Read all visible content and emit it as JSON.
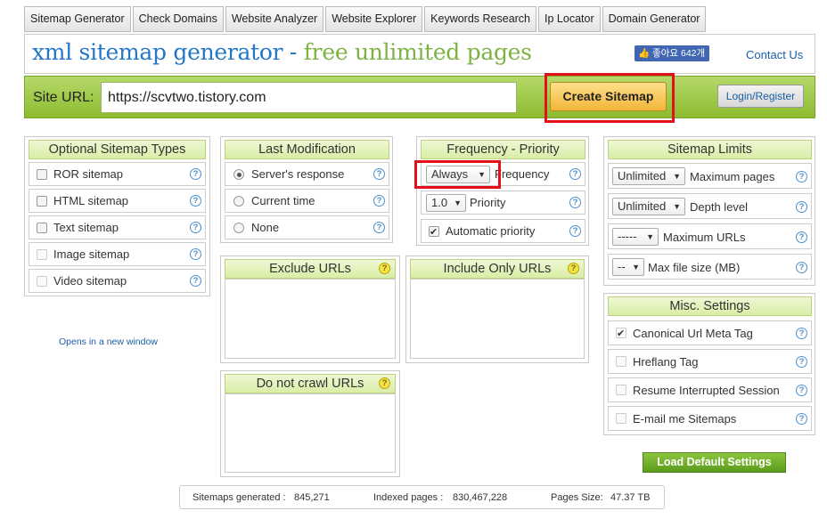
{
  "tabs": [
    "Sitemap Generator",
    "Check Domains",
    "Website Analyzer",
    "Website Explorer",
    "Keywords Research",
    "Ip Locator",
    "Domain Generator"
  ],
  "header": {
    "title_main": "xml sitemap generator",
    "title_dash": " - ",
    "title_free": "free unlimited pages",
    "like_label": "좋아요 642개",
    "contact": "Contact Us"
  },
  "urlbar": {
    "label": "Site URL:",
    "value": "https://scvtwo.tistory.com",
    "create": "Create Sitemap",
    "login": "Login/Register"
  },
  "optional": {
    "title": "Optional Sitemap Types",
    "items": [
      "ROR sitemap",
      "HTML sitemap",
      "Text sitemap",
      "Image sitemap",
      "Video sitemap"
    ]
  },
  "lastmod": {
    "title": "Last Modification",
    "items": [
      "Server's response",
      "Current time",
      "None"
    ],
    "selected": "Server's response"
  },
  "frequency": {
    "title": "Frequency - Priority",
    "frequency_value": "Always",
    "frequency_label": "Frequency",
    "priority_value": "1.0",
    "priority_label": "Priority",
    "auto_label": "Automatic priority",
    "auto_checked": true
  },
  "limits": {
    "title": "Sitemap Limits",
    "rows": [
      {
        "value": "Unlimited",
        "label": "Maximum pages"
      },
      {
        "value": "Unlimited",
        "label": "Depth level"
      },
      {
        "value": "-----",
        "label": "Maximum URLs"
      },
      {
        "value": "--",
        "label": "Max file size (MB)"
      }
    ]
  },
  "exclude": {
    "title": "Exclude URLs"
  },
  "include": {
    "title": "Include Only URLs"
  },
  "nocrawl": {
    "title": "Do not crawl URLs"
  },
  "misc": {
    "title": "Misc. Settings",
    "items": [
      "Canonical Url Meta Tag",
      "Hreflang Tag",
      "Resume Interrupted Session",
      "E-mail me Sitemaps"
    ],
    "checked": [
      true,
      false,
      false,
      false
    ]
  },
  "opens_note": "Opens in a new window",
  "load_default": "Load Default Settings",
  "stats": {
    "generated_label": "Sitemaps generated :",
    "generated": "845,271",
    "indexed_label": "Indexed pages :",
    "indexed": "830,467,228",
    "size_label": "Pages Size:",
    "size": "47.37 TB"
  },
  "colors": {
    "accent_green": "#8dbb2f",
    "title_blue": "#2277c6",
    "title_green": "#7cb342",
    "highlight_red": "#e3101a"
  }
}
